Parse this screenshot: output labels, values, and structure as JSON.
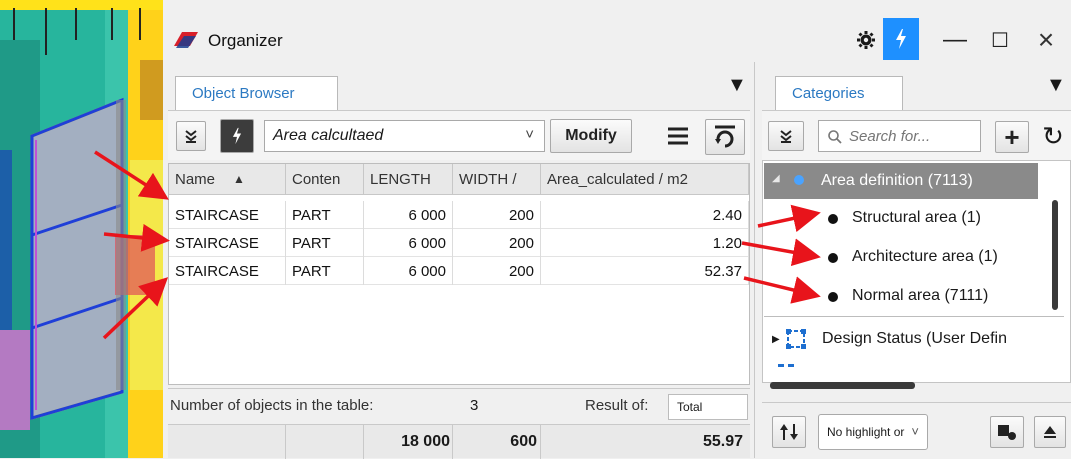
{
  "window": {
    "title": "Organizer",
    "settings_icon": "gear-icon",
    "pin_icon": "lightning-pin-icon",
    "minimize_glyph": "—",
    "maximize_glyph": "☐",
    "close_glyph": "×",
    "accent": "#1e90ff"
  },
  "object_browser": {
    "tab_label": "Object Browser",
    "menu_glyph": "▼",
    "query_value": "Area calcultaed",
    "dropdown_glyph": "˅",
    "modify_label": "Modify",
    "columns": [
      "Name",
      "Conten",
      "LENGTH",
      "WIDTH /",
      "Area_calculated / m2"
    ],
    "sort_glyph": "▲",
    "rows": [
      {
        "name": "STAIRCASE",
        "content": "PART",
        "length": "6 000",
        "width": "200",
        "area": "2.40"
      },
      {
        "name": "STAIRCASE",
        "content": "PART",
        "length": "6 000",
        "width": "200",
        "area": "1.20"
      },
      {
        "name": "STAIRCASE",
        "content": "PART",
        "length": "6 000",
        "width": "200",
        "area": "52.37"
      }
    ],
    "footer": {
      "count_label": "Number of objects in the table:",
      "count_value": "3",
      "result_label": "Result of:",
      "result_select": "Total",
      "total_length": "18 000",
      "total_width": "600",
      "total_area": "55.97"
    }
  },
  "categories": {
    "tab_label": "Categories",
    "menu_glyph": "▼",
    "search_placeholder": "Search for...",
    "add_glyph": "+",
    "refresh_glyph": "↻",
    "tree": {
      "selected": "Area definition (7113)",
      "children": [
        "Structural area (1)",
        "Architecture area (1)",
        "Normal area (7111)"
      ],
      "next_group": "Design Status (User Defin"
    },
    "highlight_select": "No highlight or",
    "accent_selected_bg": "#8a8a8a"
  },
  "annotation_color": "#e8141b"
}
